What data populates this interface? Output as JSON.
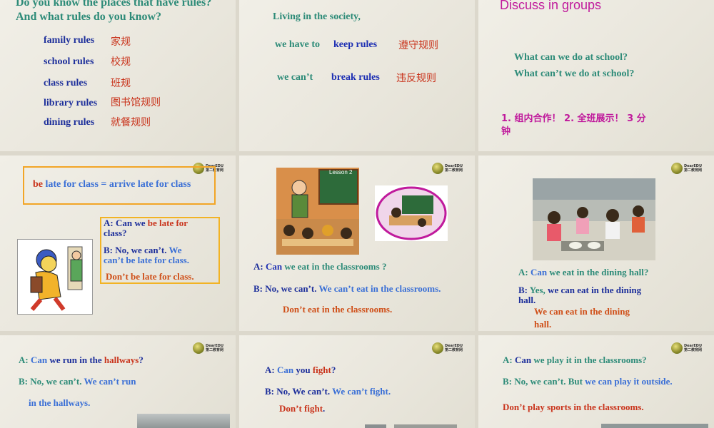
{
  "s1": {
    "q1": "Do you know the places that have rules?",
    "q2": "And what rules do you know?",
    "rules": [
      {
        "en": "family rules",
        "zh": "家规"
      },
      {
        "en": "school rules",
        "zh": "校规"
      },
      {
        "en": "class rules",
        "zh": "班规"
      },
      {
        "en": "library rules",
        "zh": "图书馆规则"
      },
      {
        "en": "dining rules",
        "zh": "就餐规则"
      }
    ]
  },
  "s2": {
    "intro": "Living in the society,",
    "r1_a": "we have to",
    "r1_b": "keep rules",
    "r1_zh": "遵守规则",
    "r2_a": "we can’t",
    "r2_b": "break rules",
    "r2_zh": "违反规则"
  },
  "s3": {
    "title": "Discuss in groups",
    "q1": "What can we do at school?",
    "q2": "What can’t we do at school?",
    "task": "1. 组内合作！ 2. 全班展示！ 3 分",
    "task2": "钟"
  },
  "s4": {
    "box_red": "be",
    "box_rest": " late for class =  arrive late for class",
    "a_pre": "A: Can we ",
    "a_red": "be late for",
    "a_line2": "class?",
    "b_pre": "B: No, we can’t. ",
    "b_blue": "We",
    "b_line2": "can’t be late for class.",
    "dont": "Don’t be late for class."
  },
  "s5": {
    "board": "Lesson 2",
    "a_pre": "A: ",
    "a_can": "Can",
    "a_rest": " we eat in the classrooms ?",
    "b_pre": "B: No, we can’t. ",
    "b_blue": "We can’t eat in the classrooms.",
    "dont": "Don’t eat in the classrooms."
  },
  "s6": {
    "a_pre": "A: ",
    "a_can": "Can",
    "a_rest": " we eat in the dining hall?",
    "b_pre": "B: ",
    "b_yes": "Yes,",
    "b_rest": " we can eat in the dining",
    "b_line2": "hall.",
    "we_can": "We can eat in the dining",
    "we_can2": "hall."
  },
  "s7": {
    "a_pre": "A: ",
    "a_can": "Can",
    "a_mid": " we run in the ",
    "a_red": "hallways",
    "a_q": "?",
    "b_pre": "B: No, we can’t. ",
    "b_blue": "We can’t run",
    "b_line2": "in the hallways."
  },
  "s8": {
    "a_pre": "A: ",
    "a_can": "Can",
    "a_mid": " you ",
    "a_red": "fight",
    "a_q": "?",
    "b_pre": "B: No, We can’t. ",
    "b_blue": "We can’t fight.",
    "dont_a": "Don’t fight",
    "dont_b": "."
  },
  "s9": {
    "a_pre": "A: ",
    "a_can": "Can",
    "a_rest": " we play it in the classrooms?",
    "b_pre": "B: No, we can’t. But ",
    "b_blue": "we can play it outside.",
    "dont": "Don’t play sports in the classrooms."
  }
}
